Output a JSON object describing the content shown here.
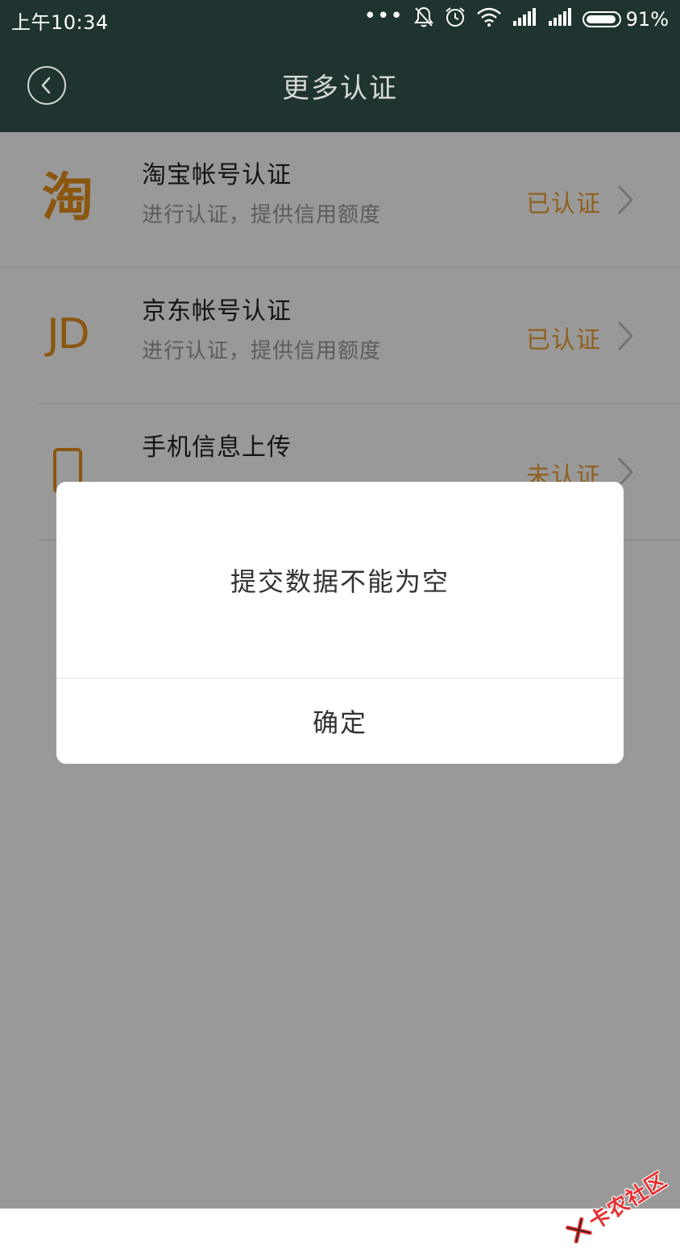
{
  "status_bar": {
    "time": "上午10:34",
    "dots": "•••",
    "battery_percent": "91%"
  },
  "header": {
    "title": "更多认证",
    "back_icon": "chevron-left-circle-icon"
  },
  "items": [
    {
      "icon": "taobao-icon",
      "icon_glyph": "淘",
      "title": "淘宝帐号认证",
      "subtitle": "进行认证，提供信用额度",
      "status": "已认证"
    },
    {
      "icon": "jd-icon",
      "icon_glyph": "JD",
      "title": "京东帐号认证",
      "subtitle": "进行认证，提供信用额度",
      "status": "已认证"
    },
    {
      "icon": "phone-icon",
      "title": "手机信息上传",
      "status": "未认证"
    }
  ],
  "dialog": {
    "message": "提交数据不能为空",
    "confirm_label": "确定"
  },
  "watermark": {
    "text": "卡农社区"
  },
  "colors": {
    "header_bg": "#1f3430",
    "accent": "#f0a033",
    "icon": "#e8901c"
  }
}
